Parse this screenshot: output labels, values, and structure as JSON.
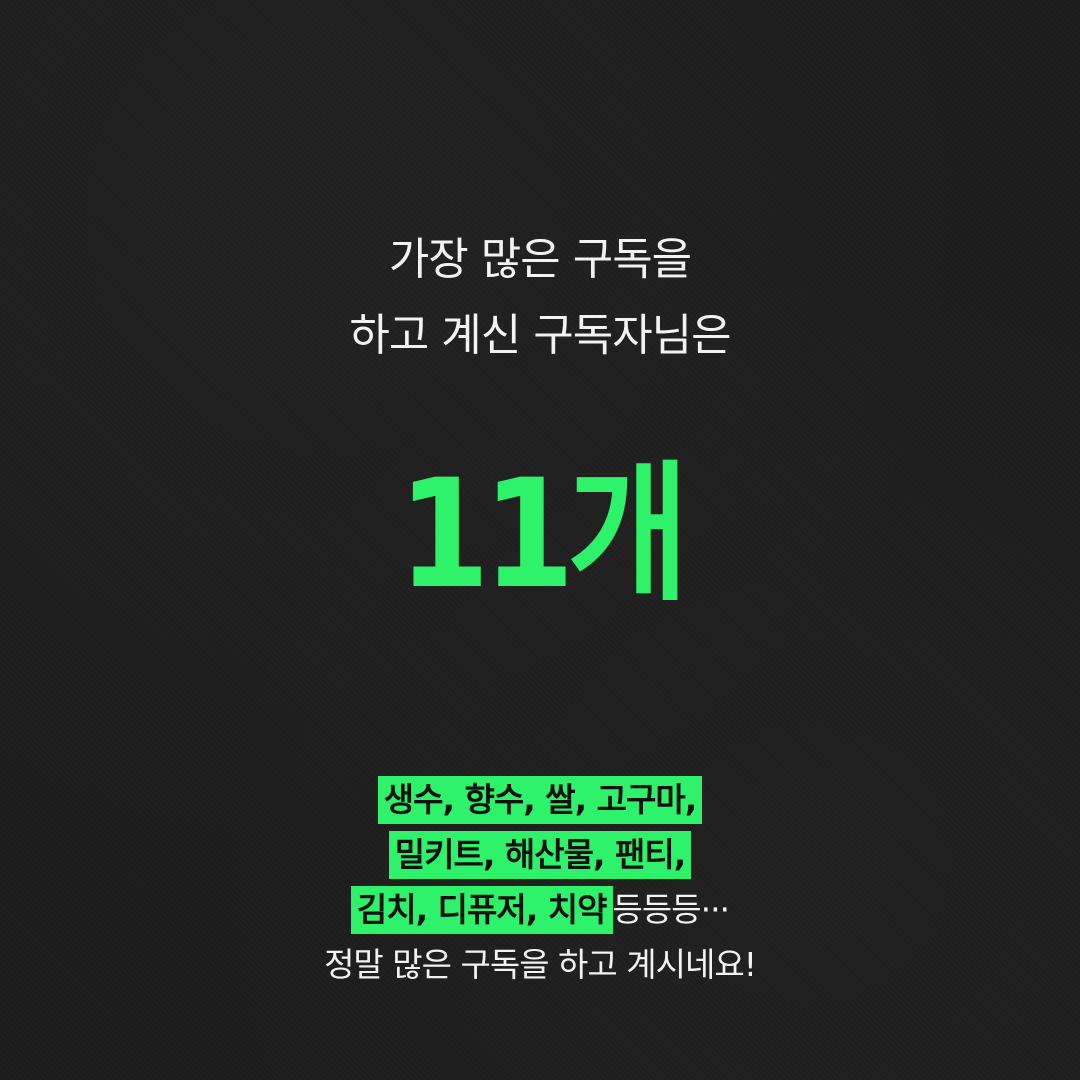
{
  "headline": {
    "line1": "가장 많은 구독을",
    "line2": "하고 계신 구독자님은"
  },
  "count": "11개",
  "items": {
    "line1": "생수, 향수, 쌀, 고구마,",
    "line2": "밀키트, 해산물, 팬티,",
    "line3_highlight": "김치, 디퓨저, 치약",
    "line3_tail": "등등등···",
    "closing": "정말 많은 구독을 하고 계시네요!"
  },
  "colors": {
    "background": "#1c1c1c",
    "accent": "#2ef26a",
    "text": "#f2f2f2"
  }
}
